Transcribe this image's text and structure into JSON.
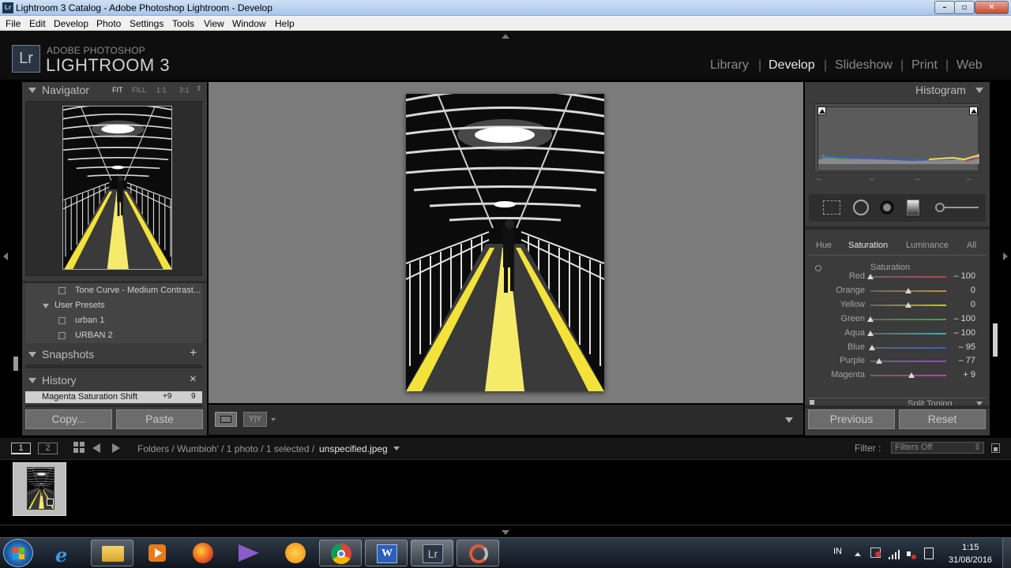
{
  "window": {
    "title": "Lightroom 3 Catalog - Adobe Photoshop Lightroom - Develop",
    "icon_label": "Lr",
    "controls": {
      "minimize": "–",
      "maximize": "▫",
      "close": "✕"
    }
  },
  "menu": [
    "File",
    "Edit",
    "Develop",
    "Photo",
    "Settings",
    "Tools",
    "View",
    "Window",
    "Help"
  ],
  "brand": {
    "logo": "Lr",
    "line1": "ADOBE PHOTOSHOP",
    "line2": "LIGHTROOM 3"
  },
  "modules": {
    "items": [
      "Library",
      "Develop",
      "Slideshow",
      "Print",
      "Web"
    ],
    "active": "Develop"
  },
  "navigator": {
    "title": "Navigator",
    "zoom": [
      "FIT",
      "FILL",
      "1:1",
      "3:1"
    ],
    "zoom_active": "FIT"
  },
  "presets": {
    "items": [
      {
        "label": "Tone Curve - Medium Contrast..."
      },
      {
        "label": "User Presets",
        "folder": true
      },
      {
        "label": "urban 1"
      },
      {
        "label": "URBAN 2"
      }
    ]
  },
  "snapshots": {
    "title": "Snapshots",
    "add": "+"
  },
  "history": {
    "title": "History",
    "clear": "×",
    "entries": [
      {
        "label": "Magenta Saturation Shift",
        "delta": "+9",
        "value": "9"
      }
    ]
  },
  "left_buttons": {
    "copy": "Copy...",
    "paste": "Paste"
  },
  "histogram": {
    "title": "Histogram",
    "dashes": [
      "–",
      "–",
      "–",
      "–"
    ]
  },
  "hsl": {
    "tabs": [
      "Hue",
      "Saturation",
      "Luminance",
      "All"
    ],
    "active_tab": "Saturation",
    "section_label": "Saturation",
    "sliders": [
      {
        "name": "Red",
        "value": "– 100",
        "num": -100,
        "color": "#c0404a"
      },
      {
        "name": "Orange",
        "value": "0",
        "num": 0,
        "color": "#c88a3a"
      },
      {
        "name": "Yellow",
        "value": "0",
        "num": 0,
        "color": "#c8c03a"
      },
      {
        "name": "Green",
        "value": "– 100",
        "num": -100,
        "color": "#4ca04a"
      },
      {
        "name": "Aqua",
        "value": "– 100",
        "num": -100,
        "color": "#3ab0b0"
      },
      {
        "name": "Blue",
        "value": "– 95",
        "num": -95,
        "color": "#3a5ec8"
      },
      {
        "name": "Purple",
        "value": "– 77",
        "num": -77,
        "color": "#8a4cc0"
      },
      {
        "name": "Magenta",
        "value": "+ 9",
        "num": 9,
        "color": "#c040a8"
      }
    ],
    "next_section": "Split Toning"
  },
  "right_buttons": {
    "previous": "Previous",
    "reset": "Reset"
  },
  "filmbar": {
    "screen1": "1",
    "screen2": "2",
    "path_prefix": "Folders / Wumbioh' / 1 photo / 1 selected /",
    "filename": "unspecified.jpeg",
    "filter_label": "Filter :",
    "filter_value": "Filters Off"
  },
  "toolbar": {
    "compare": "Y|Y"
  },
  "taskbar": {
    "lang": "IN",
    "time": "1:15",
    "date": "31/08/2016"
  },
  "colors": {
    "panel": "#3b3b3b",
    "center_bg": "#7b7b7b",
    "accent_yellow": "#f2e23a"
  }
}
